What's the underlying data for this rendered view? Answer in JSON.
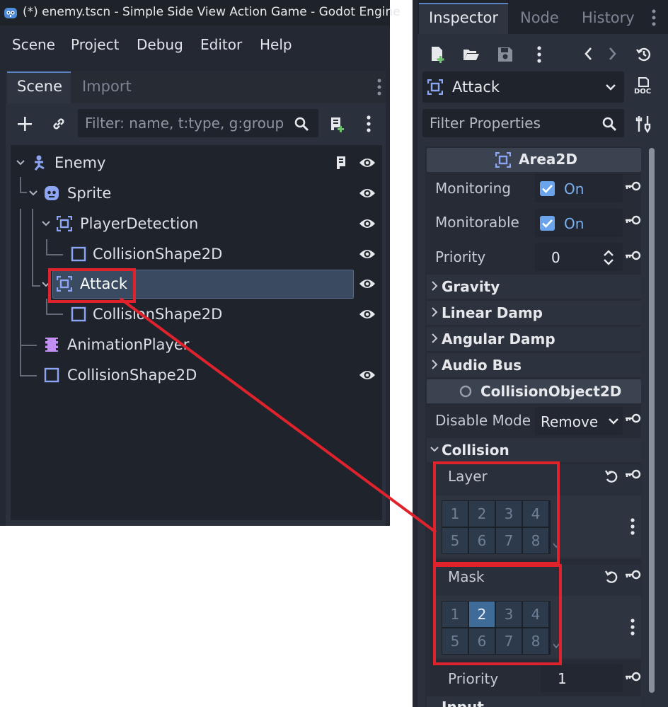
{
  "scene_window": {
    "title": "(*) enemy.tscn - Simple Side View Action Game - Godot Engine",
    "menu": [
      "Scene",
      "Project",
      "Debug",
      "Editor",
      "Help"
    ],
    "tabs": [
      "Scene",
      "Import"
    ],
    "filter_placeholder": "Filter: name, t:type, g:group",
    "tree": [
      {
        "label": "Enemy",
        "icon": "character-node-icon"
      },
      {
        "label": "Sprite",
        "icon": "sprite-node-icon"
      },
      {
        "label": "PlayerDetection",
        "icon": "area2d-node-icon"
      },
      {
        "label": "CollisionShape2D",
        "icon": "collision-shape-icon"
      },
      {
        "label": "Attack",
        "icon": "area2d-node-icon",
        "selected": true
      },
      {
        "label": "CollisionShape2D",
        "icon": "collision-shape-icon"
      },
      {
        "label": "AnimationPlayer",
        "icon": "animation-player-icon"
      },
      {
        "label": "CollisionShape2D",
        "icon": "collision-shape-icon"
      }
    ]
  },
  "inspector": {
    "tabs": [
      "Inspector",
      "Node",
      "History"
    ],
    "node_name": "Attack",
    "doc_label": "DOC",
    "filter_placeholder": "Filter Properties",
    "area2d": {
      "header": "Area2D",
      "monitoring_label": "Monitoring",
      "monitoring_value": "On",
      "monitorable_label": "Monitorable",
      "monitorable_value": "On",
      "priority_label": "Priority",
      "priority_value": "0",
      "groups": [
        "Gravity",
        "Linear Damp",
        "Angular Damp",
        "Audio Bus"
      ]
    },
    "collision_object": {
      "header": "CollisionObject2D",
      "disable_mode_label": "Disable Mode",
      "disable_mode_value": "Remove",
      "collision_group": "Collision",
      "layer_label": "Layer",
      "mask_label": "Mask",
      "layer_cells": [
        "1",
        "2",
        "3",
        "4",
        "5",
        "6",
        "7",
        "8"
      ],
      "layer_active": [],
      "mask_cells": [
        "1",
        "2",
        "3",
        "4",
        "5",
        "6",
        "7",
        "8"
      ],
      "mask_active": [
        2
      ],
      "priority_label": "Priority",
      "priority_value": "1",
      "next_group": "Input"
    }
  },
  "colors": {
    "accent": "#5b82c3",
    "highlight_red": "#e0222c",
    "active_cell": "#3f6b99"
  }
}
